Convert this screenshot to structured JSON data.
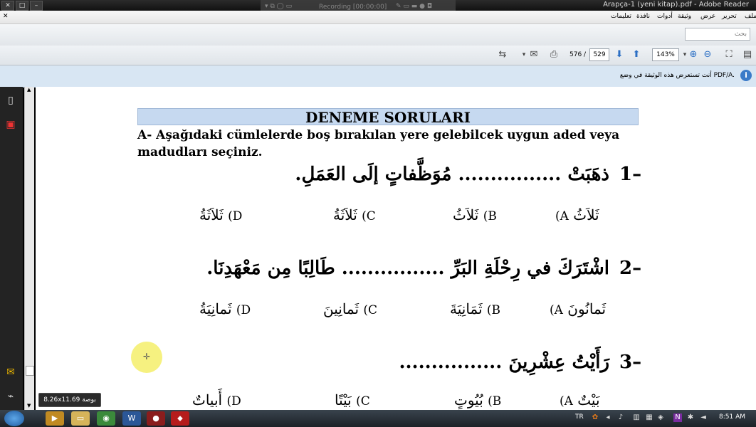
{
  "window": {
    "title": "Arapça-1 (yeni kitap).pdf - Adobe Reader",
    "recording": "Recording [00:00:00]"
  },
  "menu": [
    "ملف",
    "تحرير",
    "عرض",
    "وثيقة",
    "أدوات",
    "نافذة",
    "تعليمات"
  ],
  "search": {
    "placeholder": "بحث"
  },
  "toolbar": {
    "current_page": "576",
    "separator": "/",
    "total_pages": "529",
    "zoom": "143%"
  },
  "infobar": {
    "message": "أنت تستعرض هذه الوثيقة في وضع PDF/A."
  },
  "document": {
    "heading": "DENEME SORULARI",
    "instruction": "A- Aşağıdaki cümlelerde boş bırakılan yere gelebilcek uygun aded veya madudları seçiniz.",
    "questions": [
      {
        "number": "1",
        "text": "ذهَبَتْ ................ مُوَظَّفاتٍ إلَى العَمَلِ.",
        "options": [
          {
            "letter": "(A",
            "text": "ثَلاَثُ"
          },
          {
            "letter": "(B",
            "text": "ثَلاَثُ"
          },
          {
            "letter": "(C",
            "text": "ثَلاَثَةُ"
          },
          {
            "letter": "(D",
            "text": "ثَلاَثَةُ"
          }
        ]
      },
      {
        "number": "2",
        "text": "اشْتَرَكَ في رِحْلَةِ البَرِّ ................ طَالِبًا مِن مَعْهَدِنَا.",
        "options": [
          {
            "letter": "(A",
            "text": "ثَمانُونَ"
          },
          {
            "letter": "(B",
            "text": "ثَمَانِيَةَ"
          },
          {
            "letter": "(C",
            "text": "ثَمانِينَ"
          },
          {
            "letter": "(D",
            "text": "ثَمانِيَةُ"
          }
        ]
      },
      {
        "number": "3",
        "text": "رَأَيْتُ عِشْرِينَ ................",
        "options": [
          {
            "letter": "(A",
            "text": "بَيْتٌ"
          },
          {
            "letter": "(B",
            "text": "بُيُوتٍ"
          },
          {
            "letter": "(C",
            "text": "بَيْتًا"
          },
          {
            "letter": "(D",
            "text": "أَبياتٌ"
          }
        ]
      }
    ]
  },
  "statusbar": {
    "page_size": "8.26x11.69 بوصة"
  },
  "taskbar": {
    "language": "TR",
    "time": "8:51 AM"
  }
}
